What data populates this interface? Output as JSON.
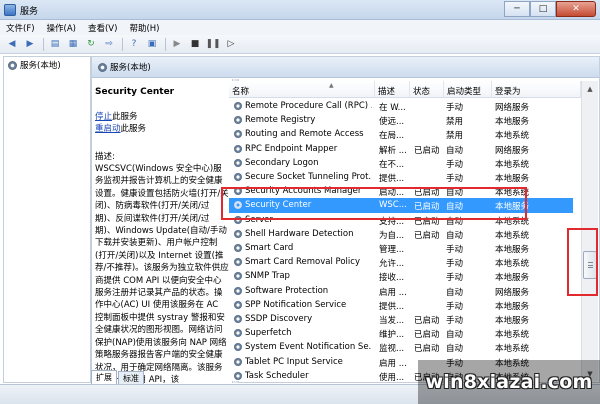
{
  "window": {
    "title": "服务"
  },
  "menu": [
    "文件(F)",
    "操作(A)",
    "查看(V)",
    "帮助(H)"
  ],
  "toolbar": {
    "icons": [
      "back-icon",
      "forward-icon",
      "console-tree-icon",
      "properties-icon",
      "refresh-icon",
      "export-icon",
      "help-icon",
      "properties-sheet-icon",
      "start-service-icon",
      "stop-service-icon",
      "pause-service-icon",
      "restart-service-icon"
    ]
  },
  "tree": {
    "root": "服务(本地)"
  },
  "main": {
    "header": "服务(本地)",
    "detail": {
      "service_name": "Security Center",
      "stop_link": "停止",
      "stop_suffix": "此服务",
      "restart_link": "重启动",
      "restart_suffix": "此服务",
      "desc_label": "描述:",
      "description": "WSCSVC(Windows 安全中心)服务监视并报告计算机上的安全健康设置。健康设置包括防火墙(打开/关闭)、防病毒软件(打开/关闭/过期)、反间谍软件(打开/关闭/过期)、Windows Update(自动/手动下载并安装更新)、用户帐户控制(打开/关闭)以及 Internet 设置(推荐/不推荐)。该服务为独立软件供应商提供 COM API 以便向安全中心服务注册并记录其产品的状态。操作中心(AC) UI 使用该服务在 AC 控制面板中提供 systray 警报和安全健康状况的图形视图。网络访问保护(NAP)使用该服务向 NAP 网络策略服务器报告客户端的安全健康状况，用于确定网络隔离。该服务还有一个公用 API，该"
    },
    "columns": {
      "name": "名称",
      "desc": "描述",
      "status": "状态",
      "startup": "启动类型",
      "logon": "登录为"
    },
    "rows": [
      {
        "name": "Remote Procedure Call (RPC) ...",
        "desc": "在 W...",
        "status": "",
        "startup": "手动",
        "logon": "网络服务"
      },
      {
        "name": "Remote Registry",
        "desc": "使远...",
        "status": "",
        "startup": "禁用",
        "logon": "本地服务"
      },
      {
        "name": "Routing and Remote Access",
        "desc": "在局...",
        "status": "",
        "startup": "禁用",
        "logon": "本地系统"
      },
      {
        "name": "RPC Endpoint Mapper",
        "desc": "解析 ...",
        "status": "已启动",
        "startup": "自动",
        "logon": "网络服务"
      },
      {
        "name": "Secondary Logon",
        "desc": "在不...",
        "status": "",
        "startup": "手动",
        "logon": "本地系统"
      },
      {
        "name": "Secure Socket Tunneling Prot...",
        "desc": "提供...",
        "status": "",
        "startup": "手动",
        "logon": "本地服务"
      },
      {
        "name": "Security Accounts Manager",
        "desc": "启动...",
        "status": "已启动",
        "startup": "自动",
        "logon": "本地系统"
      },
      {
        "name": "Security Center",
        "desc": "WSC...",
        "status": "已启动",
        "startup": "自动",
        "logon": "本地服务",
        "selected": true
      },
      {
        "name": "Server",
        "desc": "支持...",
        "status": "已启动",
        "startup": "自动",
        "logon": "本地系统"
      },
      {
        "name": "Shell Hardware Detection",
        "desc": "为自...",
        "status": "已启动",
        "startup": "自动",
        "logon": "本地系统"
      },
      {
        "name": "Smart Card",
        "desc": "管理...",
        "status": "",
        "startup": "手动",
        "logon": "本地服务"
      },
      {
        "name": "Smart Card Removal Policy",
        "desc": "允许...",
        "status": "",
        "startup": "手动",
        "logon": "本地系统"
      },
      {
        "name": "SNMP Trap",
        "desc": "接收...",
        "status": "",
        "startup": "手动",
        "logon": "本地服务"
      },
      {
        "name": "Software Protection",
        "desc": "启用 ...",
        "status": "",
        "startup": "自动",
        "logon": "网络服务"
      },
      {
        "name": "SPP Notification Service",
        "desc": "提供...",
        "status": "",
        "startup": "手动",
        "logon": "本地服务"
      },
      {
        "name": "SSDP Discovery",
        "desc": "当发...",
        "status": "已启动",
        "startup": "手动",
        "logon": "本地服务"
      },
      {
        "name": "Superfetch",
        "desc": "维护...",
        "status": "已启动",
        "startup": "自动",
        "logon": "本地系统"
      },
      {
        "name": "System Event Notification Se...",
        "desc": "监视...",
        "status": "已启动",
        "startup": "自动",
        "logon": "本地系统"
      },
      {
        "name": "Tablet PC Input Service",
        "desc": "启用 ...",
        "status": "",
        "startup": "手动",
        "logon": "本地系统"
      },
      {
        "name": "Task Scheduler",
        "desc": "使用...",
        "status": "已启动",
        "startup": "自动",
        "logon": "本地系统"
      }
    ]
  },
  "tabs": [
    "扩展",
    "标准"
  ],
  "watermark": "win8xiazai.com",
  "colors": {
    "selection": "#3399ff",
    "highlight_box": "#e2292d",
    "link": "#1a47b6"
  }
}
